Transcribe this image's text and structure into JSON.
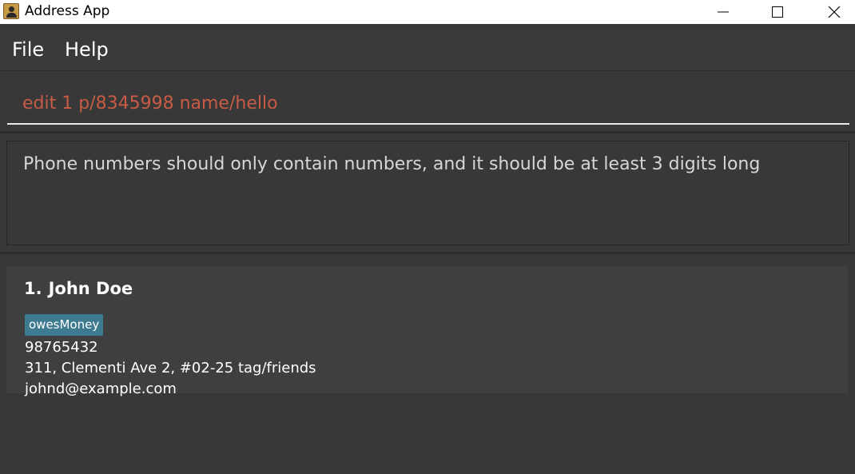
{
  "window": {
    "title": "Address App"
  },
  "menu": {
    "items": [
      {
        "label": "File"
      },
      {
        "label": "Help"
      }
    ]
  },
  "command": {
    "value": "edit 1 p/8345998 name/hello",
    "text_color": "#c75b45"
  },
  "result": {
    "message": "Phone numbers should only contain numbers, and it should be at least 3 digits long"
  },
  "persons": [
    {
      "index": "1.",
      "name": "John Doe",
      "tags": [
        "owesMoney"
      ],
      "phone": "98765432",
      "address": "311, Clementi Ave 2, #02-25 tag/friends",
      "email": "johnd@example.com"
    }
  ],
  "colors": {
    "background": "#383838",
    "card": "#3e3f41",
    "tag": "#3e7b91",
    "error_text": "#c75b45"
  },
  "icons": {
    "app": "address-book-icon",
    "minimize": "minimize-icon",
    "maximize": "maximize-icon",
    "close": "close-icon"
  }
}
